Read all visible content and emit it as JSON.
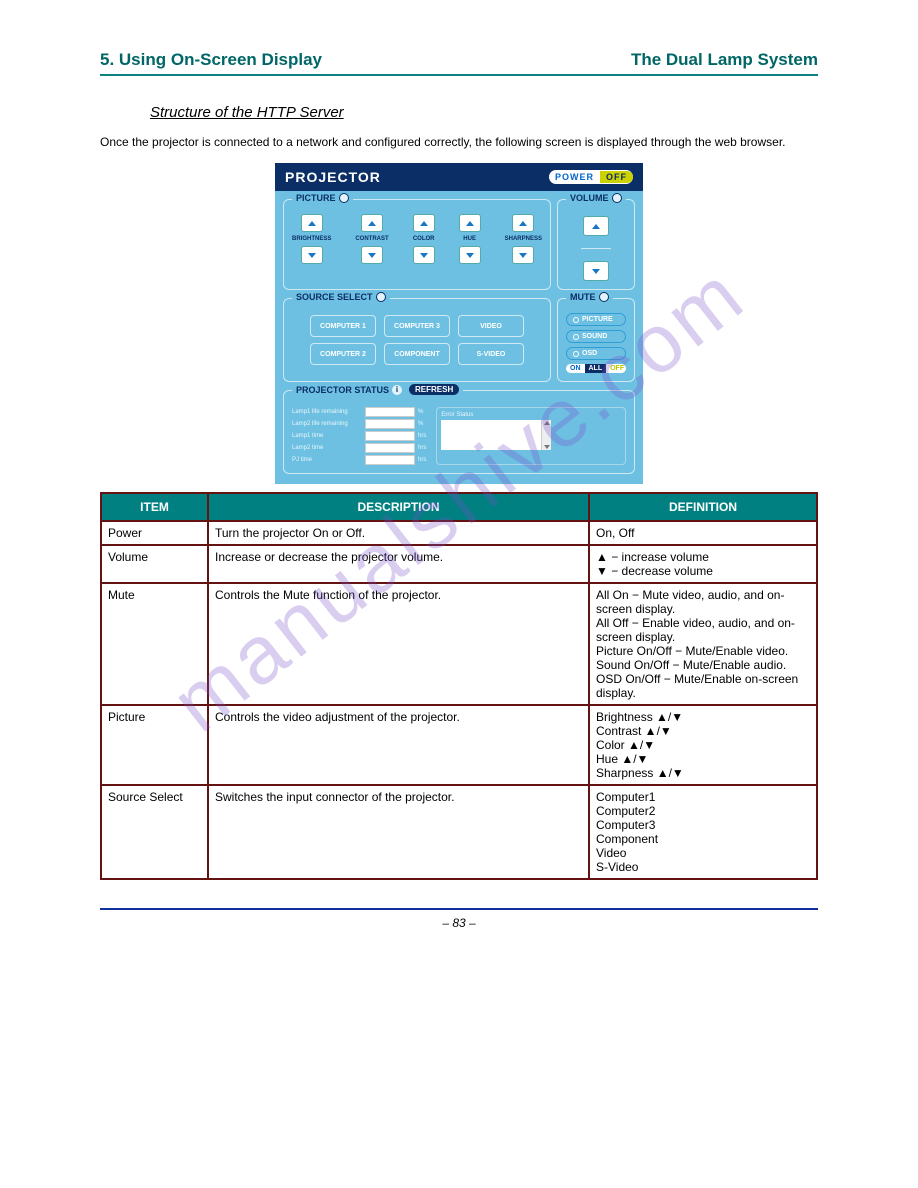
{
  "header": {
    "section": "5. Using On-Screen Display",
    "title": "The Dual Lamp System"
  },
  "section": {
    "subtitle": "Structure of the HTTP Server",
    "intro": "Once the projector is connected to a network and configured correctly, the following screen is displayed through the web browser."
  },
  "watermark": "manualshive.com",
  "projector": {
    "title": "PROJECTOR",
    "power": {
      "on": "POWER",
      "off": "OFF"
    },
    "picture": {
      "label": "PICTURE",
      "controls": [
        "BRIGHTNESS",
        "CONTRAST",
        "COLOR",
        "HUE",
        "SHARPNESS"
      ]
    },
    "volume": {
      "label": "VOLUME"
    },
    "source": {
      "label": "SOURCE SELECT",
      "rows": [
        [
          "COMPUTER 1",
          "COMPUTER 3",
          "VIDEO"
        ],
        [
          "COMPUTER 2",
          "COMPONENT",
          "S-VIDEO"
        ]
      ]
    },
    "mute": {
      "label": "MUTE",
      "items": [
        "PICTURE",
        "SOUND",
        "OSD"
      ],
      "all": {
        "on": "ON",
        "mid": "ALL",
        "off": "OFF"
      }
    },
    "status": {
      "label": "PROJECTOR STATUS",
      "refresh": "REFRESH",
      "items": [
        {
          "label": "Lamp1 life remaining",
          "unit": "%"
        },
        {
          "label": "Lamp2 life remaining",
          "unit": "%"
        },
        {
          "label": "Lamp1 time",
          "unit": "hrs"
        },
        {
          "label": "Lamp2 time",
          "unit": "hrs"
        },
        {
          "label": "PJ time",
          "unit": "hrs"
        }
      ],
      "error_label": "Error Status"
    }
  },
  "table": {
    "headers": [
      "ITEM",
      "DESCRIPTION",
      "DEFINITION"
    ],
    "rows": [
      {
        "item": "Power",
        "desc": "Turn the projector On or Off.",
        "def": "On, Off"
      },
      {
        "item": "Volume",
        "desc": "Increase or decrease the projector volume.",
        "def": "▲ − increase volume\n▼ − decrease volume"
      },
      {
        "item": "Mute",
        "desc": "Controls the Mute function of the projector.",
        "def": "All On − Mute video, audio, and on-screen display.\nAll Off − Enable video, audio, and on-screen display.\nPicture On/Off − Mute/Enable video.\nSound On/Off − Mute/Enable audio.\nOSD On/Off − Mute/Enable on-screen display."
      },
      {
        "item": "Picture",
        "desc": "Controls the video adjustment of the projector.",
        "def": "Brightness ▲/▼\nContrast ▲/▼\nColor ▲/▼\nHue ▲/▼\nSharpness ▲/▼"
      },
      {
        "item": "Source Select",
        "desc": "Switches the input connector of the projector.",
        "def": "Computer1\nComputer2\nComputer3\nComponent\nVideo\nS-Video"
      }
    ]
  },
  "footer": {
    "page": "– 83 –"
  }
}
